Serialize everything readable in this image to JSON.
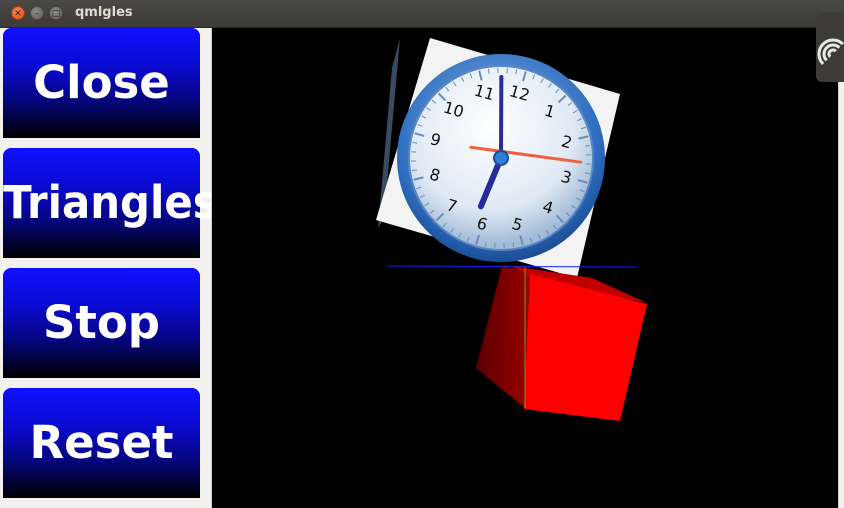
{
  "window": {
    "title": "qmlgles"
  },
  "buttons": {
    "close": "Close",
    "triangles": "Triangles",
    "stop": "Stop",
    "reset": "Reset"
  },
  "clock": {
    "numbers": [
      "12",
      "1",
      "2",
      "3",
      "4",
      "5",
      "6",
      "7",
      "8",
      "9",
      "10",
      "11"
    ]
  },
  "colors": {
    "button_top": "#1010ff",
    "button_bottom": "#000000",
    "cube_face": "#ff0000",
    "viewport_bg": "#000000",
    "titlebar": "#3c3b37"
  },
  "icons": {
    "close": "close-icon",
    "minimize": "minimize-icon",
    "maximize": "maximize-icon",
    "network": "wifi-icon"
  }
}
